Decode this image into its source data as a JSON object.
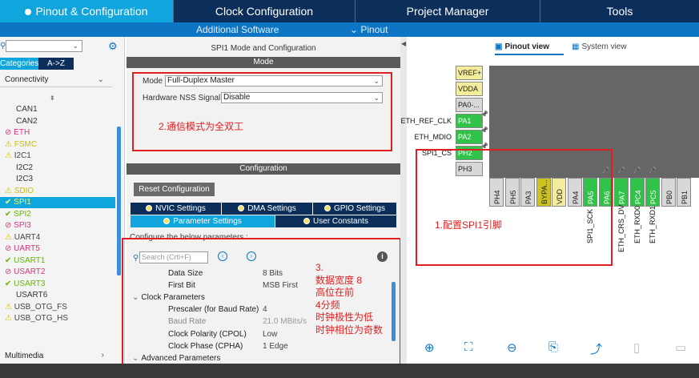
{
  "topnav": {
    "tabs": [
      {
        "label": "Pinout & Configuration",
        "active": true
      },
      {
        "label": "Clock Configuration"
      },
      {
        "label": "Project Manager"
      },
      {
        "label": "Tools"
      }
    ]
  },
  "subnav": {
    "additional_software": "Additional Software",
    "pinout": "⌄ Pinout"
  },
  "left": {
    "tab_categories": "Categories",
    "tab_az": "A->Z",
    "group_label": "Connectivity",
    "bottom_group": "Multimedia",
    "items": [
      {
        "label": "CAN1",
        "state": "ok"
      },
      {
        "label": "CAN2",
        "state": "ok"
      },
      {
        "label": "ETH",
        "state": "err"
      },
      {
        "label": "FSMC",
        "state": "warn"
      },
      {
        "label": "I2C1",
        "state": "warn-dark"
      },
      {
        "label": "I2C2",
        "state": "ok"
      },
      {
        "label": "I2C3",
        "state": "ok"
      },
      {
        "label": "SDIO",
        "state": "warn"
      },
      {
        "label": "SPI1",
        "state": "selected"
      },
      {
        "label": "SPI2",
        "state": "green"
      },
      {
        "label": "SPI3",
        "state": "err"
      },
      {
        "label": "UART4",
        "state": "warn-dark"
      },
      {
        "label": "UART5",
        "state": "err"
      },
      {
        "label": "USART1",
        "state": "green"
      },
      {
        "label": "USART2",
        "state": "err"
      },
      {
        "label": "USART3",
        "state": "green"
      },
      {
        "label": "USART6",
        "state": "ok"
      },
      {
        "label": "USB_OTG_FS",
        "state": "warn-dark"
      },
      {
        "label": "USB_OTG_HS",
        "state": "warn-dark"
      }
    ]
  },
  "mid": {
    "title": "SPI1 Mode and Configuration",
    "mode_bar": "Mode",
    "mode_label": "Mode",
    "mode_value": "Full-Duplex Master",
    "nss_label": "Hardware NSS Signal",
    "nss_value": "Disable",
    "annotation_mode": "2.通信模式为全双工",
    "config_bar": "Configuration",
    "reset_button": "Reset Configuration",
    "tabs_row1": [
      "NVIC Settings",
      "DMA Settings",
      "GPIO Settings"
    ],
    "tabs_row2": [
      "Parameter Settings",
      "User Constants"
    ],
    "configure_text": "Configure the below parameters :",
    "search_placeholder": "Search (Crtl+F)",
    "params": [
      {
        "name": "Data Size",
        "value": "8 Bits"
      },
      {
        "name": "First Bit",
        "value": "MSB First"
      }
    ],
    "clock_group": "Clock Parameters",
    "clock_params": [
      {
        "name": "Prescaler (for Baud Rate)",
        "value": "4"
      },
      {
        "name": "Baud Rate",
        "value": "21.0 MBits/s",
        "dim": true
      },
      {
        "name": "Clock Polarity (CPOL)",
        "value": "Low"
      },
      {
        "name": "Clock Phase (CPHA)",
        "value": "1 Edge"
      }
    ],
    "advanced_group": "Advanced Parameters",
    "annotation_params": [
      "3.",
      "数据宽度 8",
      "高位在前",
      "4分频",
      "时钟极性为低",
      "时钟相位为奇数"
    ]
  },
  "right": {
    "pinout_view": "Pinout view",
    "system_view": "System view",
    "annotation_pin": "1.配置SPI1引脚",
    "left_pins": [
      {
        "label": "VREF+",
        "style": "yellow"
      },
      {
        "label": "VDDA",
        "style": "yellow"
      },
      {
        "label": "PA0-...",
        "style": "gray"
      },
      {
        "label": "PA1",
        "style": "green",
        "signal": "ETH_REF_CLK"
      },
      {
        "label": "PA2",
        "style": "green",
        "signal": "ETH_MDIO"
      },
      {
        "label": "PH2",
        "style": "green",
        "signal": "SPI1_CS"
      },
      {
        "label": "PH3",
        "style": "gray"
      }
    ],
    "bottom_pins": [
      {
        "label": "PH4",
        "style": "gray"
      },
      {
        "label": "PH5",
        "style": "gray"
      },
      {
        "label": "PA3",
        "style": "gray"
      },
      {
        "label": "BYPA...",
        "style": "yellow2"
      },
      {
        "label": "VDD",
        "style": "yellow"
      },
      {
        "label": "PA4",
        "style": "gray"
      },
      {
        "label": "PA5",
        "style": "green",
        "signal": "SPI1_SCK"
      },
      {
        "label": "PA6",
        "style": "green"
      },
      {
        "label": "PA7",
        "style": "green",
        "signal": "ETH_CRS_DV"
      },
      {
        "label": "PC4",
        "style": "green",
        "signal": "ETH_RXD0"
      },
      {
        "label": "PC5",
        "style": "green",
        "signal": "ETH_RXD1"
      },
      {
        "label": "PB0",
        "style": "gray"
      },
      {
        "label": "PB1",
        "style": "gray"
      }
    ]
  },
  "colors": {
    "nav_dark": "#0b2f5a",
    "nav_active": "#10a5dc",
    "pin_green": "#31c24a",
    "annotation_red": "#e02020"
  }
}
